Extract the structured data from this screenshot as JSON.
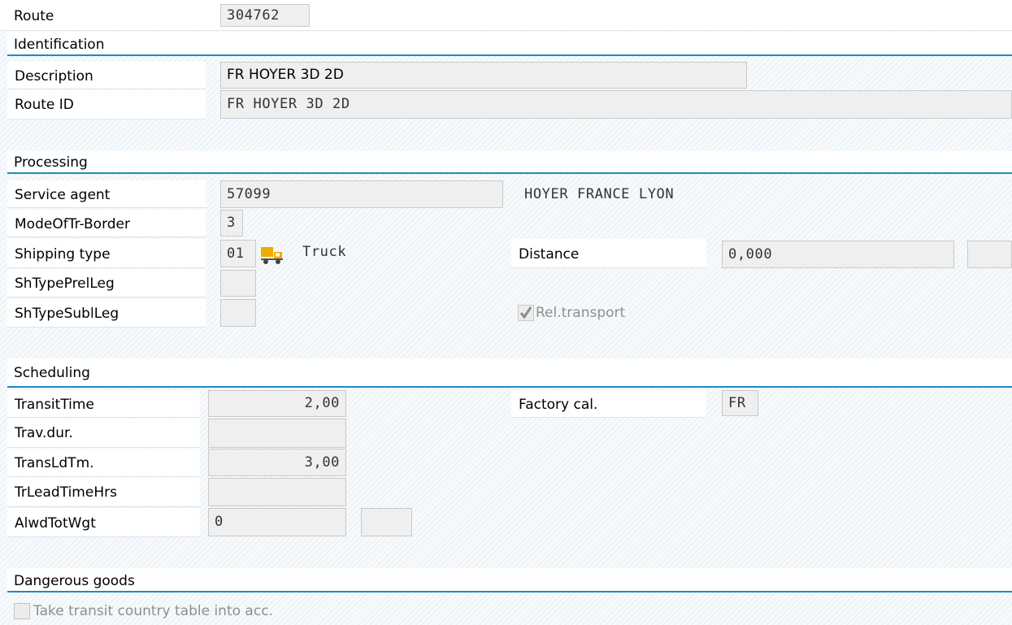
{
  "header": {
    "route_label": "Route",
    "route_value": "304762"
  },
  "identification": {
    "title": "Identification",
    "description_label": "Description",
    "description_value": "FR HOYER 3D 2D",
    "route_id_label": "Route ID",
    "route_id_value": "FR HOYER 3D 2D"
  },
  "processing": {
    "title": "Processing",
    "service_agent_label": "Service agent",
    "service_agent_value": "57099",
    "service_agent_name": "HOYER FRANCE LYON",
    "mode_border_label": "ModeOfTr-Border",
    "mode_border_value": "3",
    "shipping_type_label": "Shipping type",
    "shipping_type_value": "01",
    "shipping_type_icon": "truck-icon",
    "shipping_type_text": "Truck",
    "distance_label": "Distance",
    "distance_value": "0,000",
    "distance_unit": "",
    "sh_type_prel_label": "ShTypePrelLeg",
    "sh_type_prel_value": "",
    "sh_type_subl_label": "ShTypeSublLeg",
    "sh_type_subl_value": "",
    "rel_transport_label": "Rel.transport",
    "rel_transport_checked": true
  },
  "scheduling": {
    "title": "Scheduling",
    "transit_time_label": "TransitTime",
    "transit_time_value": "2,00",
    "factory_cal_label": "Factory cal.",
    "factory_cal_value": "FR",
    "trav_dur_label": "Trav.dur.",
    "trav_dur_value": "",
    "trans_ld_tm_label": "TransLdTm.",
    "trans_ld_tm_value": "3,00",
    "tr_lead_time_label": "TrLeadTimeHrs",
    "tr_lead_time_value": "",
    "alwd_tot_wgt_label": "AlwdTotWgt",
    "alwd_tot_wgt_value": "0",
    "alwd_tot_wgt_unit": ""
  },
  "dangerous_goods": {
    "title": "Dangerous goods",
    "transit_table_label": "Take transit country table into acc.",
    "transit_table_checked": false
  },
  "colors": {
    "section_line": "#1d8bc5",
    "field_bg": "#efefef",
    "truck_icon": "#f0ad00"
  }
}
